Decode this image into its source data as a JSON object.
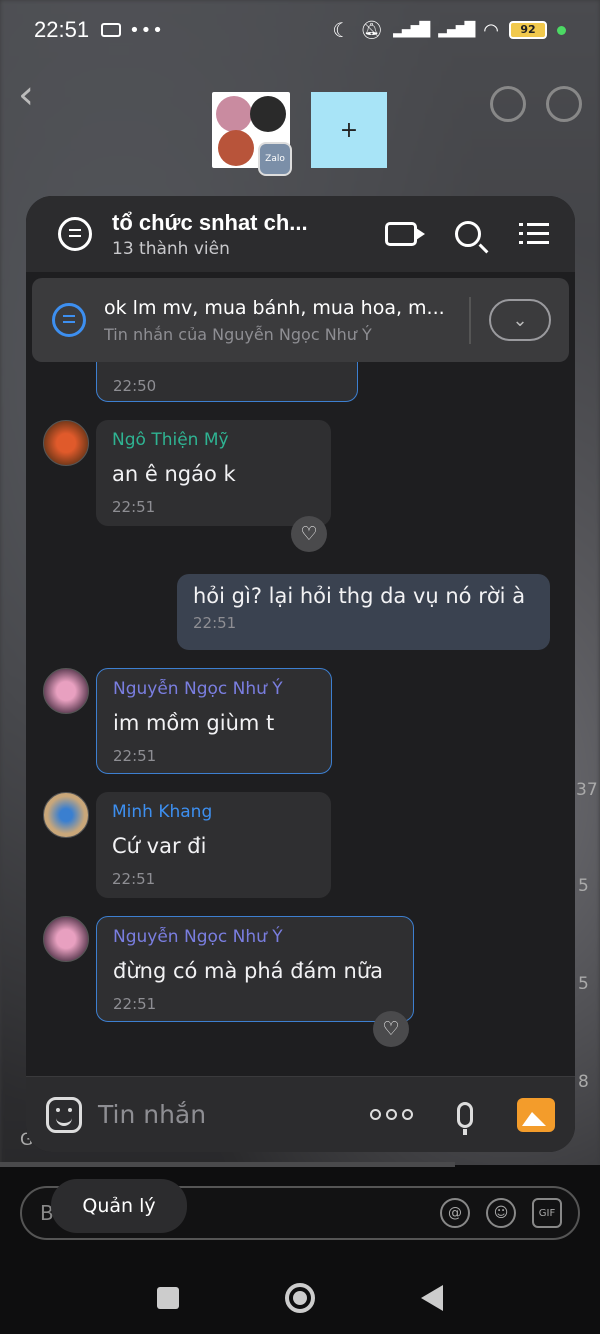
{
  "status_bar": {
    "time": "22:51",
    "left_icons": [
      "message-icon",
      "more-dots-icon"
    ],
    "battery": "92",
    "right_icons": [
      "moon-icon",
      "bell-off-icon",
      "signal-icon",
      "signal-icon",
      "wifi-icon",
      "battery-icon",
      "dot-icon"
    ]
  },
  "top_nav": {
    "back_glyph": "‹",
    "thumb2_label": "+",
    "zalo_badge": "Zalo"
  },
  "chat": {
    "title": "tổ chức snhat ch...",
    "subtitle": "13 thành viên",
    "pinned": {
      "text": "ok lm mv, mua bánh, mua hoa, m...",
      "sub": "Tin nhắn của Nguyễn Ngọc Như Ý",
      "expand_glyph": "⌄"
    },
    "messages": [
      {
        "sender": "Ngô Thiện Mỹ",
        "sender_color": "#2fb392",
        "text": "an ê ngáo k",
        "time": "22:51"
      },
      {
        "sender": "",
        "text": "hỏi gì? lại hỏi thg da vụ nó rời à",
        "time": "22:51",
        "mine": true
      },
      {
        "sender": "Nguyễn Ngọc Như Ý",
        "sender_color": "#7a7ee0",
        "text": "im mồm giùm t",
        "time": "22:51"
      },
      {
        "sender": "Minh Khang",
        "sender_color": "#3d8ff0",
        "text": "Cứ var đi",
        "time": "22:51"
      },
      {
        "sender": "Nguyễn Ngọc Như Ý",
        "sender_color": "#7a7ee0",
        "text": "đừng có mà phá đám nữa",
        "time": "22:51"
      }
    ],
    "partial_top": {
      "text": "... ... ... ... ... ...",
      "time": "22:50"
    },
    "heart_glyph": "♡",
    "composer_placeholder": "Tin nhắn"
  },
  "bottom": {
    "manage_button": "Quản lý",
    "input_letter": "B",
    "side_gi": "Gia",
    "side_numbers": [
      "37",
      "5",
      "5",
      "8"
    ],
    "icons": [
      "@",
      "☺",
      "GIF"
    ]
  }
}
